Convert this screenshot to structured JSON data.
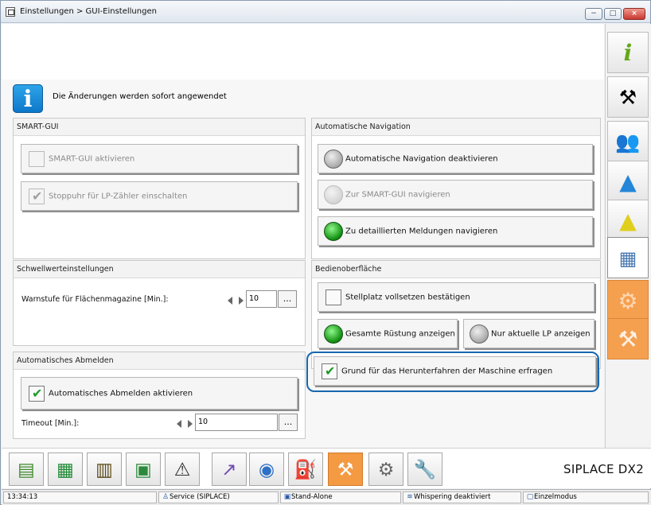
{
  "window": {
    "title": "Einstellungen > GUI-Einstellungen",
    "controls": [
      "−",
      "□",
      "×"
    ]
  },
  "info": {
    "icon": "i",
    "message": "Die Änderungen werden sofort angewendet"
  },
  "panels": {
    "smart_gui": {
      "title": "SMART-GUI",
      "activate": "SMART-GUI aktivieren",
      "stopwatch": "Stoppuhr für LP-Zähler einschalten"
    },
    "auto_nav": {
      "title": "Automatische Navigation",
      "deactivate": "Automatische Navigation deaktivieren",
      "to_smart": "Zur SMART-GUI navigieren",
      "to_details": "Zu detaillierten Meldungen navigieren"
    },
    "thresholds": {
      "title": "Schwellwerteinstellungen",
      "label": "Warnstufe für Flächenmagazine [Min.]:",
      "value": "10",
      "browse": "..."
    },
    "ui": {
      "title": "Bedienoberfläche",
      "confirm_slot": "Stellplatz vollsetzen bestätigen",
      "full_setup": "Gesamte Rüstung anzeigen",
      "current_lp": "Nur aktuelle LP anzeigen",
      "shutdown_reason": "Grund für das Herunterfahren der Maschine erfragen"
    },
    "auto_logout": {
      "title": "Automatisches Abmelden",
      "activate": "Automatisches Abmelden aktivieren",
      "timeout_label": "Timeout [Min.]:",
      "timeout_value": "10",
      "browse": "..."
    }
  },
  "sidebar": {
    "items": [
      "info-icon",
      "machine-icon",
      "users-icon",
      "maintenance-icon",
      "warning-icon",
      "settings-icon",
      "gear-orange-icon",
      "tools-orange-icon"
    ]
  },
  "taskbar": {
    "brand": "SIPLACE DX2",
    "icons": [
      "money-icon",
      "grid-icon",
      "bar-chart-icon",
      "board-icon",
      "document-warning-icon",
      "trend-icon",
      "camera-icon",
      "toolbox-icon",
      "screwdriver-icon",
      "hand-gear-icon",
      "wrench-icon"
    ]
  },
  "status": {
    "time": "13:34:13",
    "service": "Service (SIPLACE)",
    "mode": "Stand-Alone",
    "whispering": "Whispering deaktiviert",
    "single": "Einzelmodus"
  },
  "colors": {
    "accent": "#1766af",
    "green": "#1d9b2a",
    "orange": "#f39a43"
  }
}
